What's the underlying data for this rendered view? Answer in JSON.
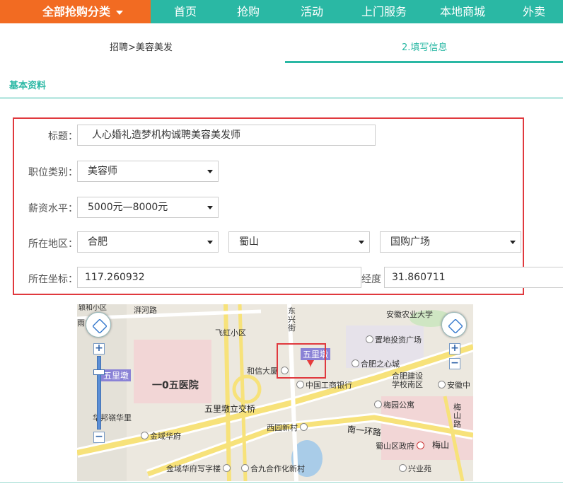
{
  "nav": {
    "category": "全部抢购分类",
    "items": [
      "首页",
      "抢购",
      "活动",
      "上门服务",
      "本地商城",
      "外卖"
    ]
  },
  "steps": {
    "step1": "招聘>美容美发",
    "step2": "2.填写信息"
  },
  "section_title": "基本资料",
  "form": {
    "title_label": "标题：",
    "title_value": "人心婚礼造梦机构诚聘美容美发师",
    "position_label": "职位类别：",
    "position_value": "美容师",
    "salary_label": "薪资水平：",
    "salary_value": "5000元—8000元",
    "region_label": "所在地区：",
    "region_city": "合肥",
    "region_district": "蜀山",
    "region_area": "国购广场",
    "coord_label": "所在坐标：",
    "lng_value": "117.260932",
    "lat_label": "经度",
    "lat_value": "31.860711"
  },
  "map": {
    "labels": {
      "l1": "湃河路",
      "l2": "飞虹小区",
      "l3": "东兴街",
      "l4": "安徽农业大学",
      "l5": "置地投资广场",
      "l6": "五里墩",
      "l7": "五里墩",
      "l8": "和信大厦",
      "l9": "一0五医院",
      "l10": "中国工商银行",
      "l11": "合肥之心城",
      "l12": "合肥建设学校南区",
      "l13": "安徽中",
      "l14": "五里墩立交桥",
      "l15": "梅园公寓",
      "l16": "华邦嶺华里",
      "l17": "金域华府",
      "l18": "西园新村",
      "l19": "南一环路",
      "l20": "梅山路",
      "l21": "蜀山区政府",
      "l22": "梅山",
      "l23": "金域华府写字楼",
      "l24": "合九合作化新村",
      "l25": "兴业苑",
      "l26": "雨",
      "l27": "颖和小区"
    },
    "colors": {
      "road_yellow": "#f7e27a",
      "road_white": "#ffffff",
      "green": "#cfe6c3",
      "pink": "#f2d6d6",
      "water": "#a9cce8",
      "marker": "#e63b3b"
    }
  }
}
